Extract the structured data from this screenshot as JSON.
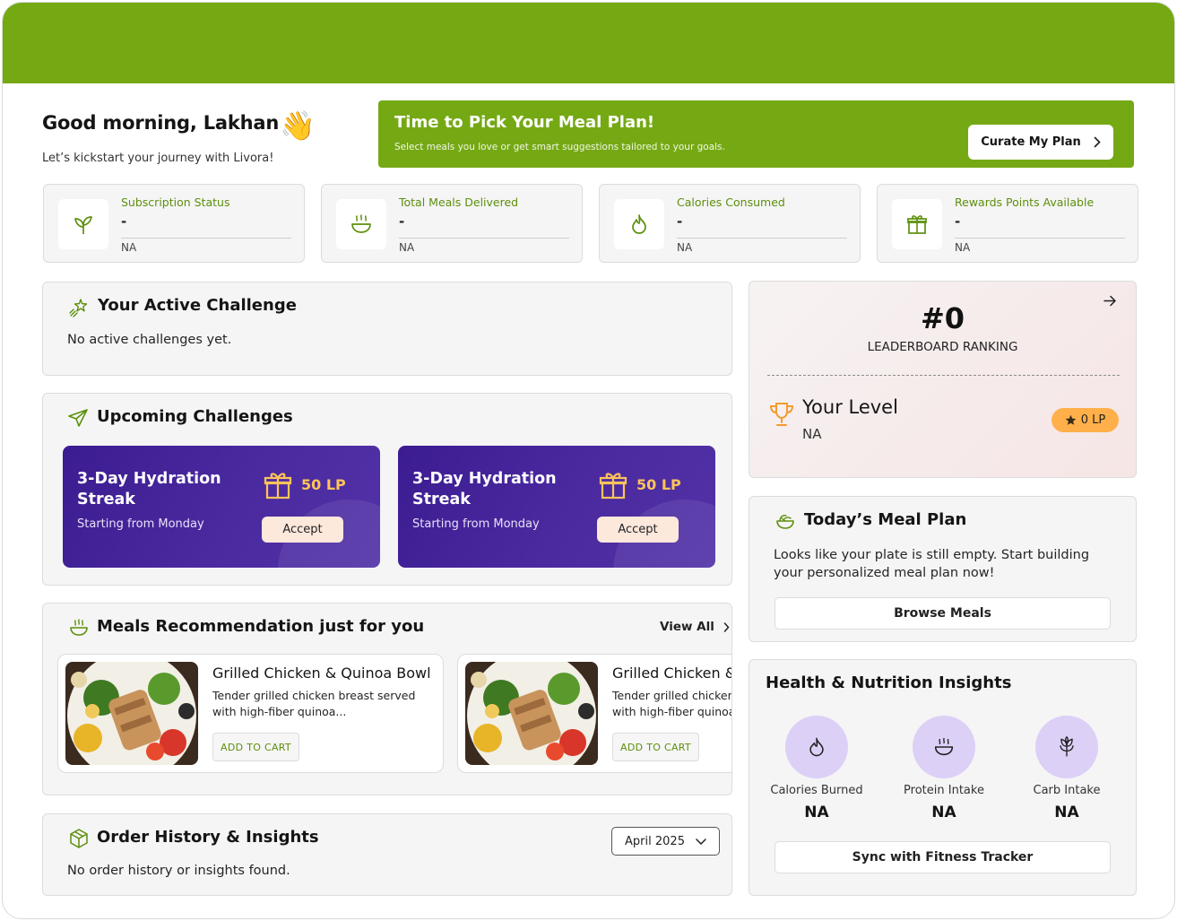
{
  "greeting": {
    "title": "Good morning, Lakhan",
    "emoji": "👋",
    "subtitle": "Let’s kickstart your journey with Livora!"
  },
  "banner": {
    "title": "Time to Pick Your Meal Plan!",
    "subtitle": "Select meals you love or get smart suggestions tailored to your goals.",
    "button_label": "Curate My Plan"
  },
  "stats": [
    {
      "label": "Subscription Status",
      "value": "-",
      "sub": "NA",
      "icon": "leaf-icon"
    },
    {
      "label": "Total Meals Delivered",
      "value": "-",
      "sub": "NA",
      "icon": "bowl-icon"
    },
    {
      "label": "Calories Consumed",
      "value": "-",
      "sub": "NA",
      "icon": "flame-icon"
    },
    {
      "label": "Rewards Points Available",
      "value": "-",
      "sub": "NA",
      "icon": "gift-icon"
    }
  ],
  "active_challenge": {
    "title": "Your Active Challenge",
    "empty_text": "No active challenges yet."
  },
  "upcoming": {
    "title": "Upcoming Challenges",
    "items": [
      {
        "title": "3-Day Hydration Streak",
        "subtitle": "Starting from Monday",
        "points": "50 LP",
        "button": "Accept"
      },
      {
        "title": "3-Day Hydration Streak",
        "subtitle": "Starting from Monday",
        "points": "50 LP",
        "button": "Accept"
      }
    ]
  },
  "meals": {
    "title": "Meals Recommendation just for you",
    "view_all": "View All",
    "items": [
      {
        "title": "Grilled Chicken & Quinoa Bowl",
        "description": "Tender grilled chicken breast served with high-fiber quinoa...",
        "button": "ADD TO CART"
      },
      {
        "title": "Grilled Chicken & Quinoa Bowl",
        "description": "Tender grilled chicken breast served with high-fiber quinoa...",
        "button": "ADD TO CART"
      }
    ]
  },
  "orders": {
    "title": "Order History & Insights",
    "month": "April 2025",
    "empty_text": "No order history or insights found."
  },
  "leaderboard": {
    "rank": "#0",
    "rank_label": "LEADERBOARD RANKING",
    "level_title": "Your Level",
    "level_value": "NA",
    "points": "0 LP"
  },
  "meal_plan": {
    "title": "Today’s Meal Plan",
    "text": "Looks like your plate is still empty. Start building your personalized meal plan now!",
    "button": "Browse Meals"
  },
  "insights": {
    "title": "Health & Nutrition Insights",
    "items": [
      {
        "label": "Calories Burned",
        "value": "NA",
        "icon": "flame-icon"
      },
      {
        "label": "Protein Intake",
        "value": "NA",
        "icon": "bowl-icon"
      },
      {
        "label": "Carb Intake",
        "value": "NA",
        "icon": "grain-icon"
      }
    ],
    "button": "Sync with Fitness Tracker"
  },
  "colors": {
    "brand_green": "#75a914",
    "label_green": "#5c8f0c",
    "challenge_purple": "#3c1c91",
    "points_orange": "#ffb04a",
    "insight_lavender": "#dcd0f7"
  }
}
